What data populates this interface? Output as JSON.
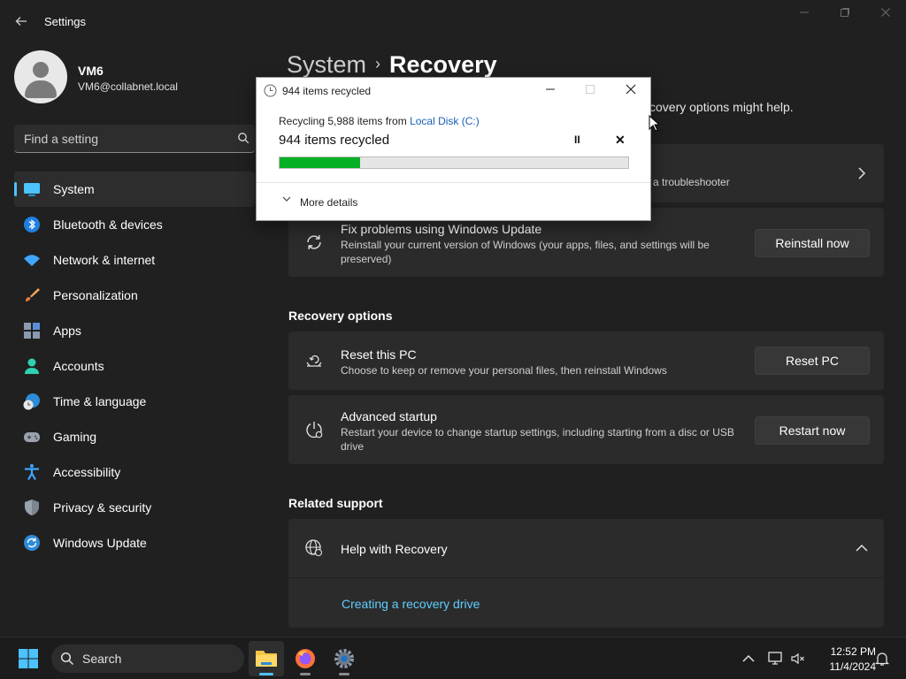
{
  "window": {
    "title": "Settings",
    "back_icon": "arrow-left-icon",
    "minimize_icon": "minimize-icon",
    "maximize_icon": "maximize-icon",
    "close_icon": "close-icon"
  },
  "profile": {
    "name": "VM6",
    "email": "VM6@collabnet.local"
  },
  "search": {
    "placeholder": "Find a setting"
  },
  "nav": {
    "items": [
      {
        "label": "System",
        "icon": "system-icon",
        "active": true
      },
      {
        "label": "Bluetooth & devices",
        "icon": "bluetooth-icon"
      },
      {
        "label": "Network & internet",
        "icon": "wifi-icon"
      },
      {
        "label": "Personalization",
        "icon": "brush-icon"
      },
      {
        "label": "Apps",
        "icon": "apps-icon"
      },
      {
        "label": "Accounts",
        "icon": "person-icon"
      },
      {
        "label": "Time & language",
        "icon": "globe-clock-icon"
      },
      {
        "label": "Gaming",
        "icon": "gamepad-icon"
      },
      {
        "label": "Accessibility",
        "icon": "accessibility-icon"
      },
      {
        "label": "Privacy & security",
        "icon": "shield-icon"
      },
      {
        "label": "Windows Update",
        "icon": "update-icon"
      }
    ]
  },
  "main": {
    "breadcrumb_parent": "System",
    "breadcrumb_current": "Recovery",
    "description_visible": "covery options might help.",
    "troubleshooter_visible": "a troubleshooter",
    "fix_card": {
      "title": "Fix problems using Windows Update",
      "subtitle": "Reinstall your current version of Windows (your apps, files, and settings will be preserved)",
      "button": "Reinstall now"
    },
    "recovery_options_header": "Recovery options",
    "reset_card": {
      "title": "Reset this PC",
      "subtitle": "Choose to keep or remove your personal files, then reinstall Windows",
      "button": "Reset PC"
    },
    "advanced_card": {
      "title": "Advanced startup",
      "subtitle": "Restart your device to change startup settings, including starting from a disc or USB drive",
      "button": "Restart now"
    },
    "related_support_header": "Related support",
    "help_card": {
      "title": "Help with Recovery",
      "link": "Creating a recovery drive"
    }
  },
  "dialog": {
    "title": "944 items recycled",
    "line_prefix": "Recycling 5,988 items from ",
    "source": "Local Disk (C:)",
    "status": "944 items recycled",
    "progress": 0.23,
    "pause_glyph": "II",
    "stop_glyph": "✕",
    "more_details": "More details"
  },
  "taskbar": {
    "search_placeholder": "Search",
    "time": "12:52 PM",
    "date": "11/4/2024",
    "apps": [
      "file-explorer-icon",
      "firefox-icon",
      "settings-icon"
    ]
  },
  "colors": {
    "accent": "#4cc2ff",
    "link": "#60cdff",
    "progress_green": "#06b025",
    "background": "#202020",
    "card": "#2b2b2b"
  }
}
